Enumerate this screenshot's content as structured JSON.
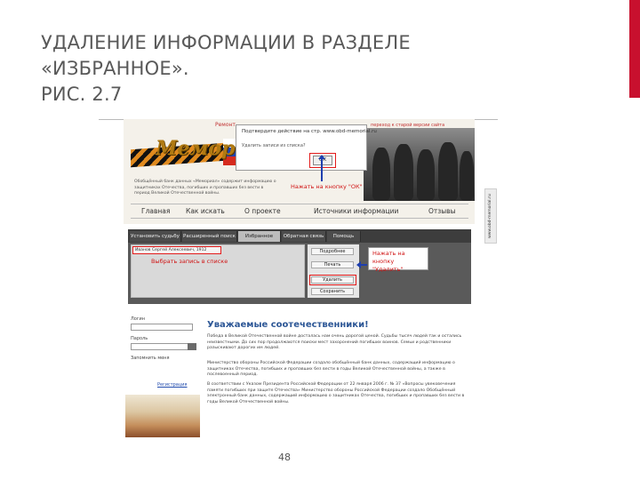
{
  "slide": {
    "title_lines": [
      "УДАЛЕНИЕ ИНФОРМАЦИИ В РАЗДЕЛЕ",
      "«ИЗБРАННОЕ».",
      "РИС. 2.7"
    ],
    "page_number": "48",
    "accent_color": "#c8102e"
  },
  "top_screenshot": {
    "header_link_left": "Ремонт",
    "header_link_right": "переход к старой версии сайта",
    "logo_text": "Мемориал",
    "dialog": {
      "message": "Подтвердите действие на стр. www.obd-memorial.ru",
      "question": "Удалить записи из списка?",
      "ok_label": "ОК"
    },
    "intro_text": "Обобщённый банк данных «Мемориал» содержит информацию о защитниках Отечества, погибших и пропавших без вести в период Великой Отечественной войны.",
    "annotation_ok": "Нажать на кнопку \"ОК\"",
    "menu": [
      "Главная",
      "Как искать",
      "О проекте",
      "Источники информации",
      "Отзывы"
    ]
  },
  "middle_screenshot": {
    "tabs": [
      {
        "label": "Установить судьбу",
        "active": false
      },
      {
        "label": "Расширенный поиск",
        "active": false
      },
      {
        "label": "Избранное",
        "active": true
      },
      {
        "label": "Обратная связь",
        "active": false
      },
      {
        "label": "Помощь",
        "active": false
      }
    ],
    "selected_record": "Иванов Сергей Алексеевич, 1912",
    "annotation_select": "Выбрать запись в списке",
    "buttons": [
      "Подробнее",
      "Печать",
      "Удалить",
      "Сохранить"
    ],
    "annotation_delete": "Нажать на кнопку \"Удалить\""
  },
  "bottom_screenshot": {
    "login": {
      "login_label": "Логин",
      "password_label": "Пароль",
      "remember_label": "Запомнить меня",
      "register_link": "Регистрация"
    },
    "heading": "Уважаемые соотечественники!",
    "paragraphs": [
      "Победа в Великой Отечественной войне досталась нам очень дорогой ценой. Судьбы тысяч людей так и остались неизвестными. До сих пор продолжаются поиски мест захоронений погибших воинов. Семьи и родственники разыскивают дорогих им людей.",
      "Министерство обороны Российской Федерации создало обобщённый банк данных, содержащий информацию о защитниках Отечества, погибших и пропавших без вести в годы Великой Отечественной войны, а также в послевоенный период.",
      "В соответствии с Указом Президента Российской Федерации от 22 января 2006 г. № 37 «Вопросы увековечения памяти погибших при защите Отечества» Министерство обороны Российской Федерации создало Обобщённый электронный банк данных, содержащий информацию о защитниках Отечества, погибших и пропавших без вести в годы Великой Отечественной войны."
    ]
  },
  "side_badge": "www.obd-memorial.ru"
}
